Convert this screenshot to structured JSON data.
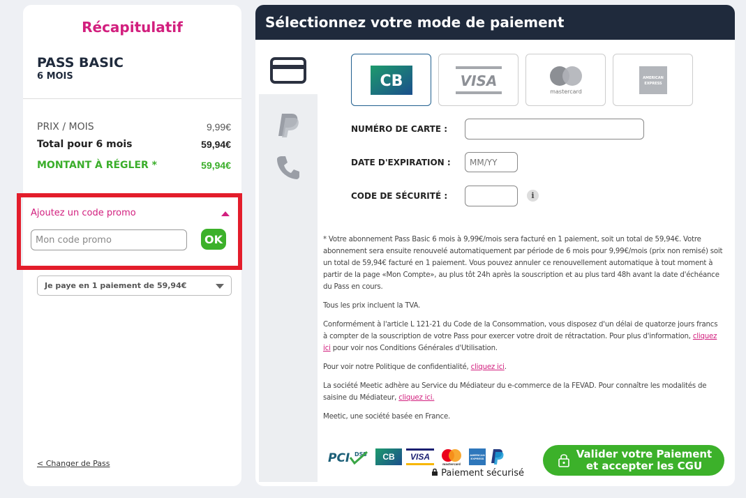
{
  "summary": {
    "title": "Récapitulatif",
    "pass_name": "PASS BASIC",
    "pass_duration": "6 MOIS",
    "price_label": "PRIX / MOIS",
    "price_value": "9,99€",
    "total_label": "Total pour 6 mois",
    "total_value": "59,94€",
    "amount_label": "MONTANT À RÉGLER *",
    "amount_value": "59,94€",
    "promo_header": "Ajoutez un code promo",
    "promo_placeholder": "Mon code promo",
    "promo_ok": "OK",
    "payment_option": "Je paye en 1 paiement de 59,94€",
    "change_pass": "< Changer de Pass"
  },
  "payment": {
    "header": "Sélectionnez votre mode de paiement",
    "tabs": [
      {
        "icon": "credit-card-icon"
      },
      {
        "icon": "paypal-icon"
      },
      {
        "icon": "phone-icon"
      }
    ],
    "cards": [
      {
        "name": "CB",
        "label": "CB"
      },
      {
        "name": "VISA",
        "label": "VISA"
      },
      {
        "name": "mastercard",
        "label": "mastercard"
      },
      {
        "name": "AMERICAN EXPRESS",
        "label": "AMERICAN EXPRESS"
      }
    ],
    "card_number_label": "NUMÉRO DE CARTE :",
    "card_number_value": "",
    "expiry_label": "DATE D'EXPIRATION :",
    "expiry_placeholder": "MM/YY",
    "security_label": "CODE DE SÉCURITÉ :",
    "security_value": "",
    "info_glyph": "i"
  },
  "legal": {
    "p1": "* Votre abonnement Pass Basic 6 mois à 9,99€/mois sera facturé en 1 paiement, soit un total de 59,94€. Votre abonnement sera ensuite renouvelé automatiquement par période de 6 mois pour 9,99€/mois (prix non remisé) soit un total de 59,94€ facturé en 1 paiement. Vous pouvez annuler ce renouvellement automatique à tout moment à partir de la page «Mon Compte», au plus tôt 24h après la souscription et au plus tard 48h avant la date d'échéance du Pass en cours.",
    "p2": "Tous les prix incluent la TVA.",
    "p3_a": "Conformément à l'article L 121-21 du Code de la Consommation, vous disposez d'un délai de quatorze jours francs à compter de la souscription de votre Pass pour exercer votre droit de rétractation. Pour plus d'information, ",
    "p3_link": "cliquez ici",
    "p3_b": " pour voir nos Conditions Générales d'Utilisation.",
    "p4_a": "Pour voir notre Politique de confidentialité, ",
    "p4_link": "cliquez ici",
    "p4_b": ".",
    "p5_a": "La société Meetic adhère au Service du Médiateur du e-commerce de la FEVAD. Pour connaître les modalités de saisine du Médiateur, ",
    "p5_link": "cliquez ici.",
    "p6": "Meetic, une société basée en France."
  },
  "footer": {
    "badges": [
      "PCI DSS",
      "CB",
      "VISA",
      "mastercard",
      "AMERICAN EXPRESS",
      "PayPal"
    ],
    "secure_label": "Paiement sécurisé",
    "validate_line1": "Valider votre Paiement",
    "validate_line2": "et accepter les CGU"
  },
  "colors": {
    "accent": "#d21f7e",
    "green": "#3cb12a",
    "header_bg": "#1f2a3c",
    "highlight_red": "#e31d2b"
  }
}
